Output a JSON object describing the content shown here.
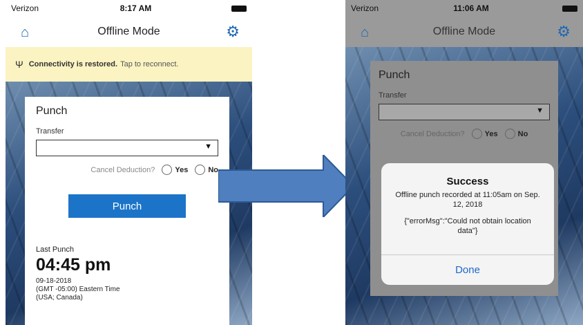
{
  "left": {
    "status": {
      "carrier": "Verizon",
      "time": "8:17 AM"
    },
    "nav": {
      "title": "Offline Mode"
    },
    "banner": {
      "bold": "Connectivity is restored.",
      "rest": "Tap to reconnect."
    },
    "card": {
      "title": "Punch",
      "transfer_label": "Transfer",
      "cancel_label": "Cancel Deduction?",
      "yes": "Yes",
      "no": "No",
      "punch_button": "Punch",
      "last_label": "Last Punch",
      "last_time": "04:45 pm",
      "last_date": "09-18-2018",
      "last_tz": "(GMT -05:00) Eastern Time",
      "last_region": "(USA; Canada)"
    }
  },
  "right": {
    "status": {
      "carrier": "Verizon",
      "time": "11:06 AM"
    },
    "nav": {
      "title": "Offline Mode"
    },
    "card": {
      "title": "Punch",
      "transfer_label": "Transfer",
      "cancel_label": "Cancel Deduction?",
      "yes": "Yes",
      "no": "No"
    },
    "dialog": {
      "title": "Success",
      "message": "Offline punch recorded at 11:05am on Sep. 12, 2018",
      "error": "{\"errorMsg\":\"Could not obtain location data\"}",
      "done": "Done"
    }
  },
  "colors": {
    "accent": "#1c74c8",
    "banner": "#fbf3c2",
    "arrow": "#4f7fbf"
  },
  "icons": [
    "home-icon",
    "gear-icon",
    "signal-icon",
    "chevron-down-icon",
    "arrow-right-icon"
  ]
}
